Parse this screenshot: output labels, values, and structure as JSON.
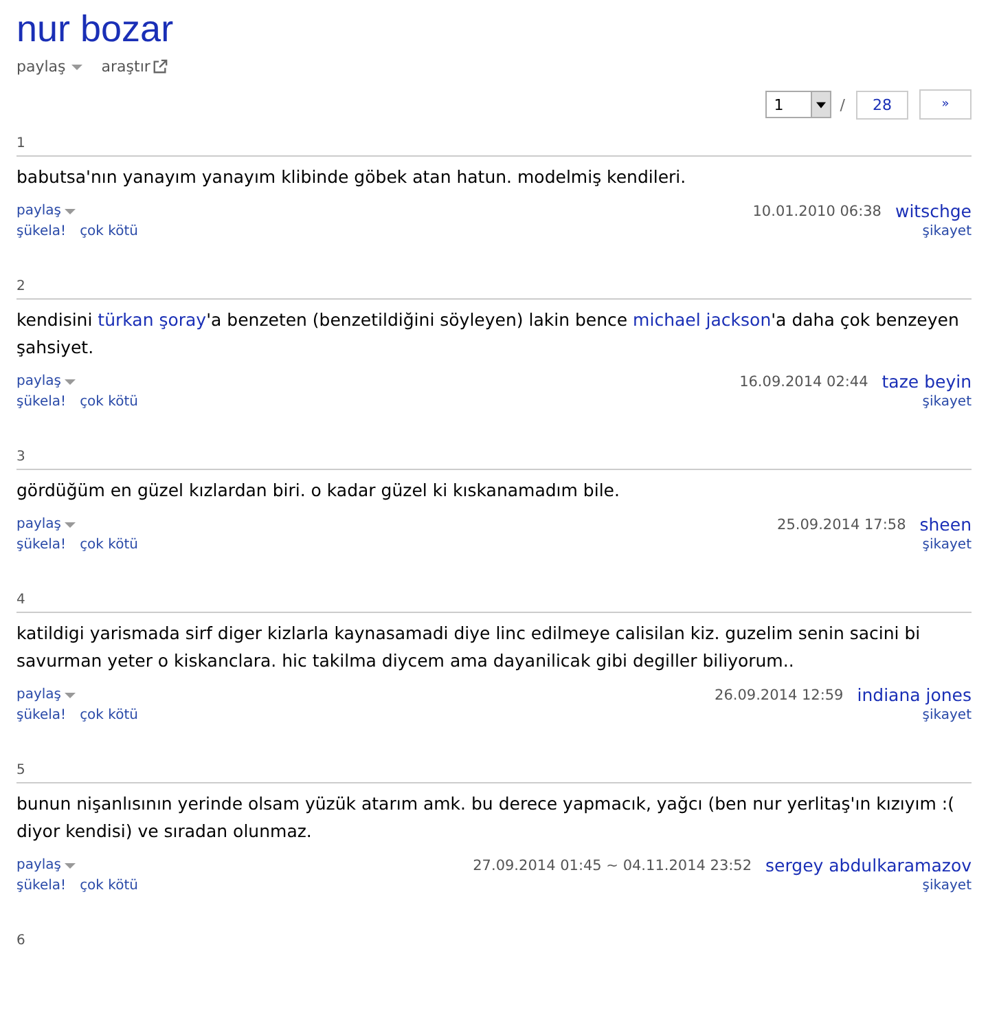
{
  "title": "nur bozar",
  "topic_actions": {
    "share": "paylaş",
    "search": "araştır"
  },
  "pager": {
    "page": "1",
    "total": "28",
    "next": "»",
    "separator": "/"
  },
  "entries": [
    {
      "number": "1",
      "segments": [
        {
          "kind": "plain",
          "text": "babutsa'nın yanayım yanayım klibinde göbek atan hatun. modelmiş kendileri."
        }
      ],
      "date": "10.01.2010 06:38",
      "author": "witschge",
      "share": "paylaş",
      "up": "şükela!",
      "down": "çok kötü",
      "report": "şikayet"
    },
    {
      "number": "2",
      "segments": [
        {
          "kind": "plain",
          "text": "kendisini "
        },
        {
          "kind": "link",
          "text": "türkan şoray"
        },
        {
          "kind": "plain",
          "text": "'a benzeten (benzetildiğini söyleyen) lakin bence "
        },
        {
          "kind": "link",
          "text": "michael jackson"
        },
        {
          "kind": "plain",
          "text": "'a daha çok benzeyen şahsiyet."
        }
      ],
      "date": "16.09.2014 02:44",
      "author": "taze beyin",
      "share": "paylaş",
      "up": "şükela!",
      "down": "çok kötü",
      "report": "şikayet"
    },
    {
      "number": "3",
      "segments": [
        {
          "kind": "plain",
          "text": "gördüğüm en güzel kızlardan biri. o kadar güzel ki kıskanamadım bile."
        }
      ],
      "date": "25.09.2014 17:58",
      "author": "sheen",
      "share": "paylaş",
      "up": "şükela!",
      "down": "çok kötü",
      "report": "şikayet"
    },
    {
      "number": "4",
      "segments": [
        {
          "kind": "plain",
          "text": "katildigi yarismada sirf diger kizlarla kaynasamadi diye linc edilmeye calisilan kiz. guzelim senin sacini bi savurman yeter o kiskanclara. hic takilma diycem ama dayanilicak gibi degiller biliyorum.."
        }
      ],
      "date": "26.09.2014 12:59",
      "author": "indiana jones",
      "share": "paylaş",
      "up": "şükela!",
      "down": "çok kötü",
      "report": "şikayet"
    },
    {
      "number": "5",
      "segments": [
        {
          "kind": "plain",
          "text": "bunun nişanlısının yerinde olsam yüzük atarım amk. bu derece yapmacık, yağcı (ben nur yerlitaş'ın kızıyım :( diyor kendisi) ve sıradan olunmaz."
        }
      ],
      "date": "27.09.2014 01:45 ~ 04.11.2014 23:52",
      "author": "sergey abdulkaramazov",
      "share": "paylaş",
      "up": "şükela!",
      "down": "çok kötü",
      "report": "şikayet"
    },
    {
      "number": "6"
    }
  ]
}
